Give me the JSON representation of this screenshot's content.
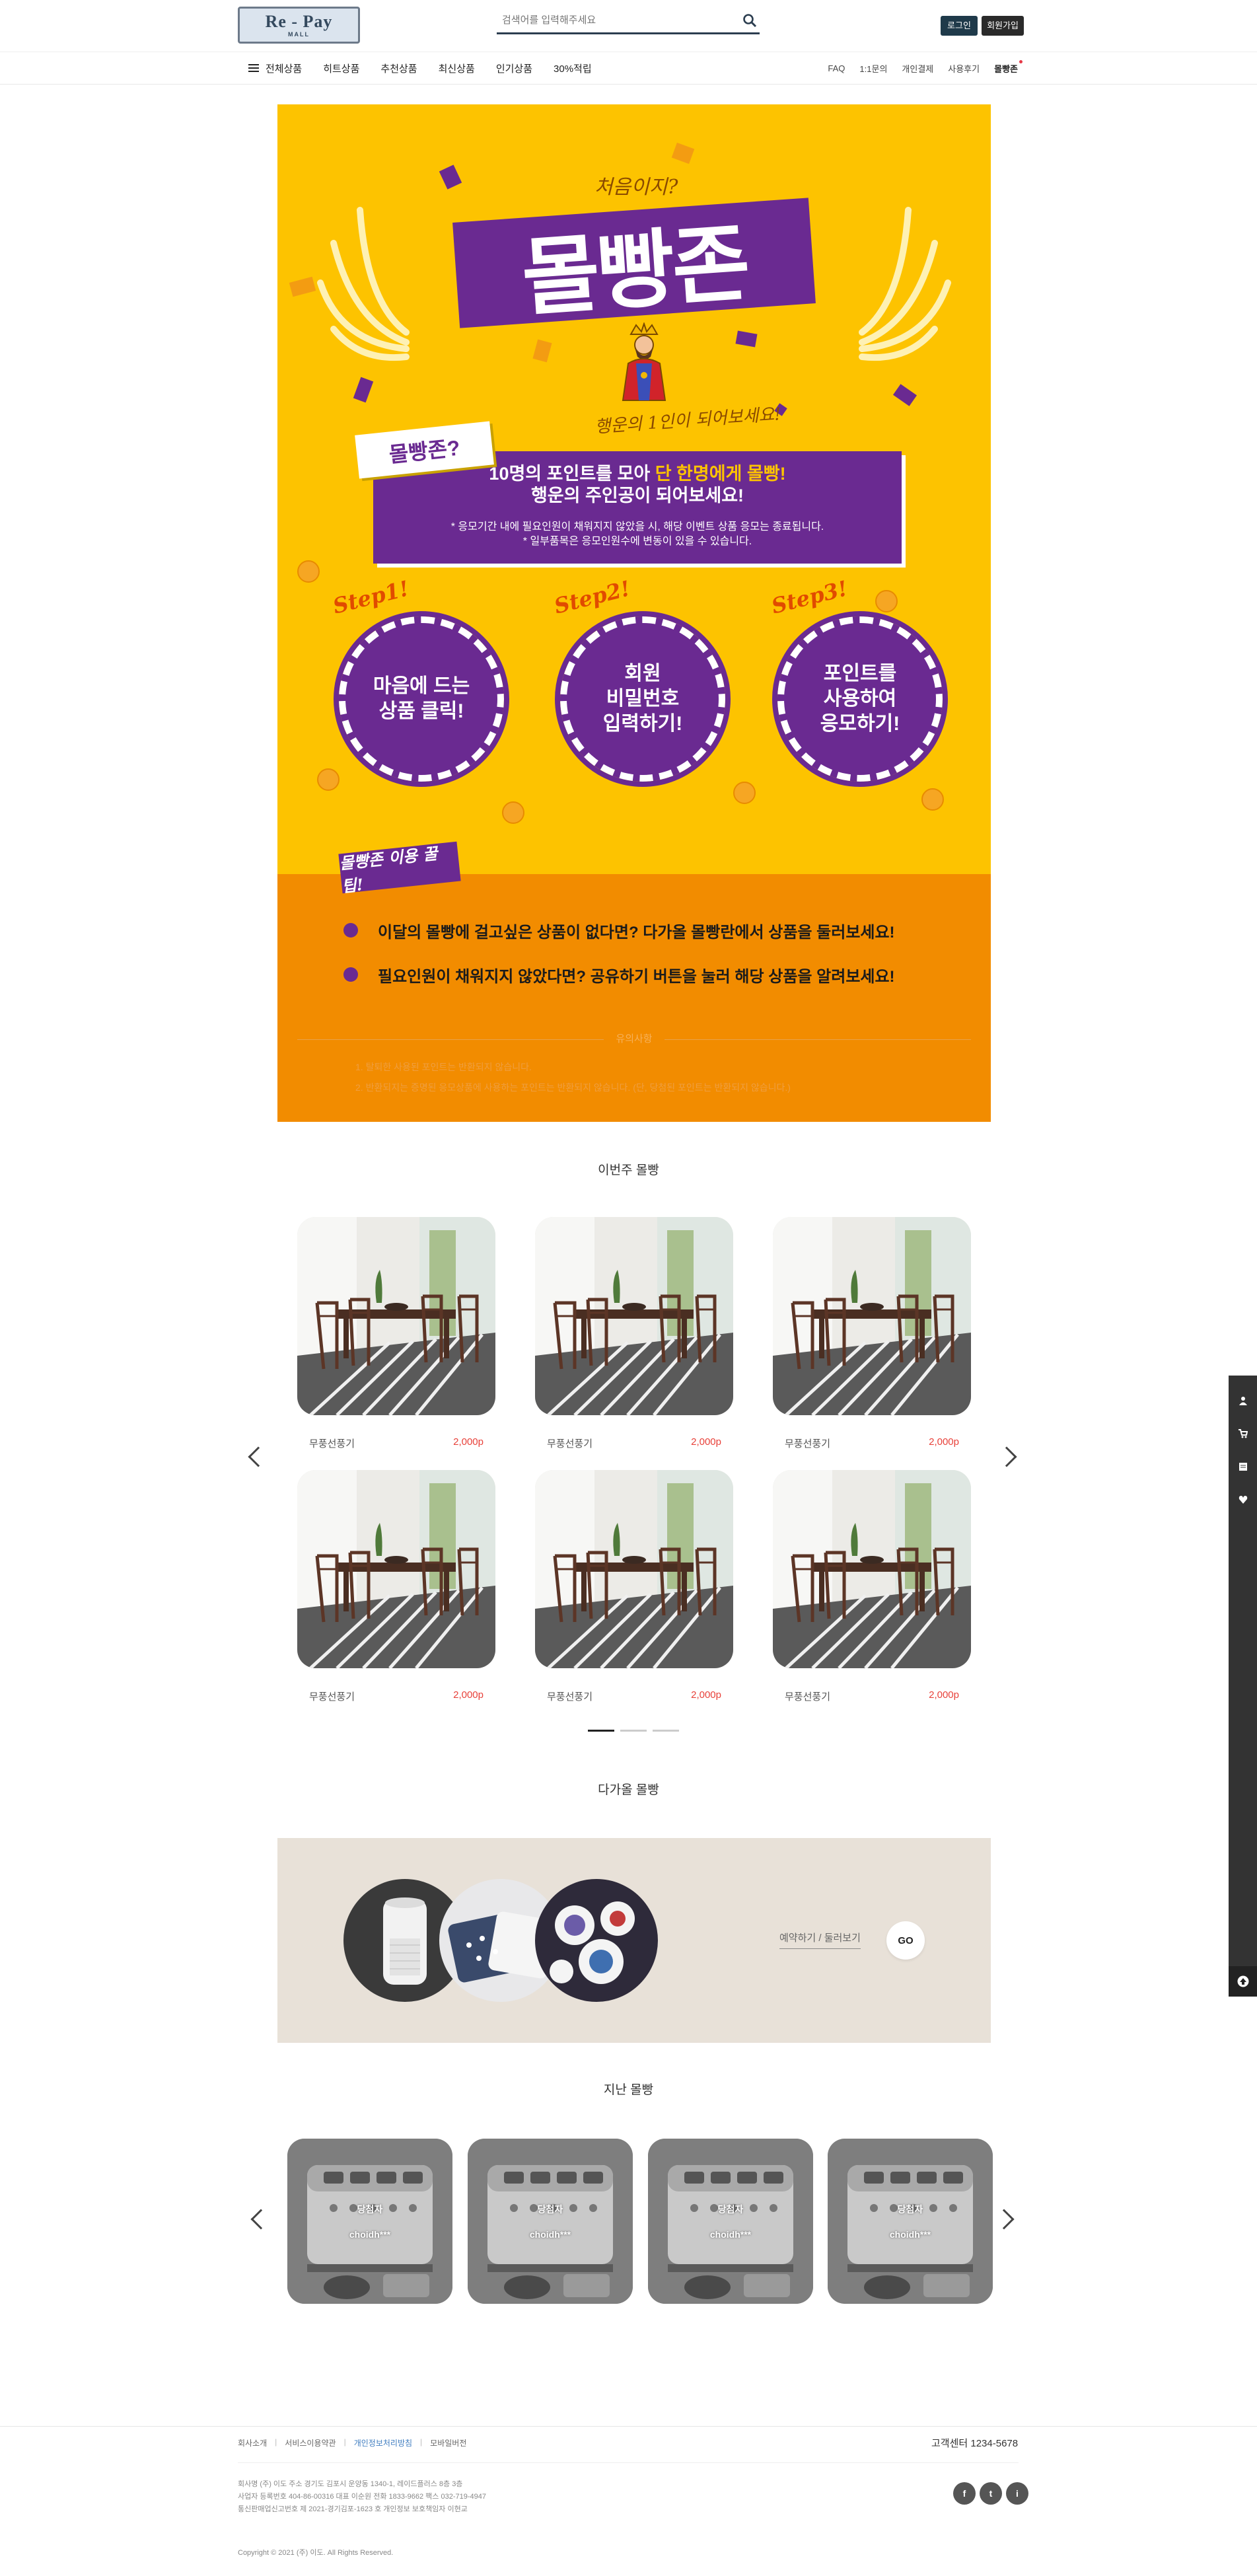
{
  "header": {
    "logo_main": "Re - Pay",
    "logo_sub": "MALL",
    "search_placeholder": "검색어를 입력해주세요",
    "login_label": "로그인",
    "join_label": "회원가입"
  },
  "nav": {
    "left": [
      "전체상품",
      "히트상품",
      "추천상품",
      "최신상품",
      "인기상품",
      "30%적립"
    ],
    "right": [
      "FAQ",
      "1:1문의",
      "개인결제",
      "사용후기",
      "몰빵존"
    ]
  },
  "banner": {
    "first_time": "처음이지?",
    "title": "몰빵존",
    "lucky": "행운의 1인이 되어보세요!",
    "what": "몰빵존?",
    "box_line1_a": "10명의 포인트를 모아 ",
    "box_line1_b": "단 한명에게 몰빵!",
    "box_line2": "행운의 주인공이 되어보세요!",
    "box_note1": "* 응모기간 내에 필요인원이 채워지지 않았을 시, 해당 이벤트 상품 응모는 종료됩니다.",
    "box_note2": "* 일부품목은 응모인원수에 변동이 있을 수 있습니다.",
    "steps": [
      {
        "label": "Step1!",
        "text1": "마음에 드는",
        "text2": "상품 클릭!",
        "text3": ""
      },
      {
        "label": "Step2!",
        "text1": "회원",
        "text2": "비밀번호",
        "text3": "입력하기!"
      },
      {
        "label": "Step3!",
        "text1": "포인트를",
        "text2": "사용하여",
        "text3": "응모하기!"
      }
    ],
    "tip_label": "몰빵존 이용 꿀팁!",
    "tips": [
      "이달의 몰빵에 걸고싶은 상품이 없다면? 다가올 몰빵란에서 상품을 둘러보세요!",
      "필요인원이 채워지지 않았다면? 공유하기 버튼을 눌러 해당 상품을 알려보세요!"
    ],
    "notice_title": "유의사항",
    "notices": [
      "1. 탈퇴한 사용된 포인트는 반환되지 않습니다.",
      "2. 반환되지는 증명된 응모상품에 사용하는 포인트는 반환되지 않습니다. (단, 당첨된 포인트는 반환되지 않습니다.)"
    ]
  },
  "this_week": {
    "title": "이번주 몰빵",
    "items": [
      {
        "name": "무풍선풍기",
        "price": "2,000p"
      },
      {
        "name": "무풍선풍기",
        "price": "2,000p"
      },
      {
        "name": "무풍선풍기",
        "price": "2,000p"
      },
      {
        "name": "무풍선풍기",
        "price": "2,000p"
      },
      {
        "name": "무풍선풍기",
        "price": "2,000p"
      },
      {
        "name": "무풍선풍기",
        "price": "2,000p"
      }
    ]
  },
  "upcoming": {
    "title": "다가올 몰빵",
    "link": "예약하기 / 둘러보기",
    "go": "GO"
  },
  "past": {
    "title": "지난 몰빵",
    "items": [
      {
        "label": "당첨자",
        "user": "choidh***"
      },
      {
        "label": "당첨자",
        "user": "choidh***"
      },
      {
        "label": "당첨자",
        "user": "choidh***"
      },
      {
        "label": "당첨자",
        "user": "choidh***"
      }
    ]
  },
  "footer": {
    "links": [
      "회사소개",
      "서비스이용약관",
      "개인정보처리방침",
      "모바일버전"
    ],
    "cs": "고객센터 1234-5678",
    "info1": "회사명 (주) 이도  주소 경기도 김포시 운양동 1340-1, 레이드플러스 8층 3층",
    "info2": "사업자 등록번호 404-86-00316  대표 이순원  전화 1833-9662  팩스 032-719-4947",
    "info3": "통신판매업신고번호 제 2021-경기김포-1623 호  개인정보 보호책임자 이현교",
    "copyright": "Copyright © 2021 (주) 이도. All Rights Reserved.",
    "sns": [
      "f",
      "t",
      "i"
    ]
  }
}
